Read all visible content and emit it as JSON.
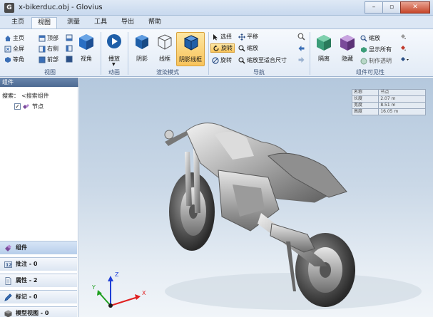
{
  "window": {
    "title": "x-bikerduc.obj - Glovius",
    "app_icon_letter": "G",
    "controls": [
      "–",
      "▫",
      "✕"
    ]
  },
  "menu": {
    "tabs": [
      "主页",
      "视图",
      "测量",
      "工具",
      "导出",
      "帮助"
    ],
    "active_tab": "视图"
  },
  "ribbon": {
    "view_group": {
      "label": "视图",
      "buttons": [
        "主页",
        "顶部",
        "全屏",
        "右侧",
        "等角",
        "前部"
      ],
      "big_button": "视角"
    },
    "animation_group": {
      "label": "动画",
      "big_button": "播放"
    },
    "render_group": {
      "label": "渲染模式",
      "buttons": [
        "阴影",
        "线框",
        "阴影线框"
      ],
      "active": "阴影线框"
    },
    "navigation_group": {
      "label": "导航",
      "buttons": [
        "选择",
        "平移",
        "旋转",
        "缩放",
        "旋转",
        "缩放至适合尺寸"
      ]
    },
    "visibility_group": {
      "label": "组件可见性",
      "big_buttons": [
        "隔离",
        "隐藏"
      ],
      "buttons": [
        "缩放",
        "显示所有",
        "制作透明"
      ]
    }
  },
  "left_panel": {
    "header": "组件",
    "search_label": "搜索：",
    "search_value": "<搜索组件",
    "tree": [
      {
        "label": "节点",
        "checked": true
      }
    ],
    "tabs": [
      {
        "label": "组件",
        "active": true
      },
      {
        "label": "批注 - 0",
        "active": false
      },
      {
        "label": "属性 - 2",
        "active": false
      },
      {
        "label": "标记 - 0",
        "active": false
      },
      {
        "label": "模型视图 - 0",
        "active": false
      }
    ]
  },
  "viewport": {
    "info_table": [
      [
        "名称",
        "节点"
      ],
      [
        "长度",
        "2.07 m"
      ],
      [
        "宽度",
        "8.51 m"
      ],
      [
        "高度",
        "16.05 m"
      ]
    ],
    "axes": {
      "x": "X",
      "y": "Y",
      "z": "Z"
    },
    "colors": {
      "x": "#e02020",
      "y": "#1fa01f",
      "z": "#1f3fd6"
    }
  }
}
